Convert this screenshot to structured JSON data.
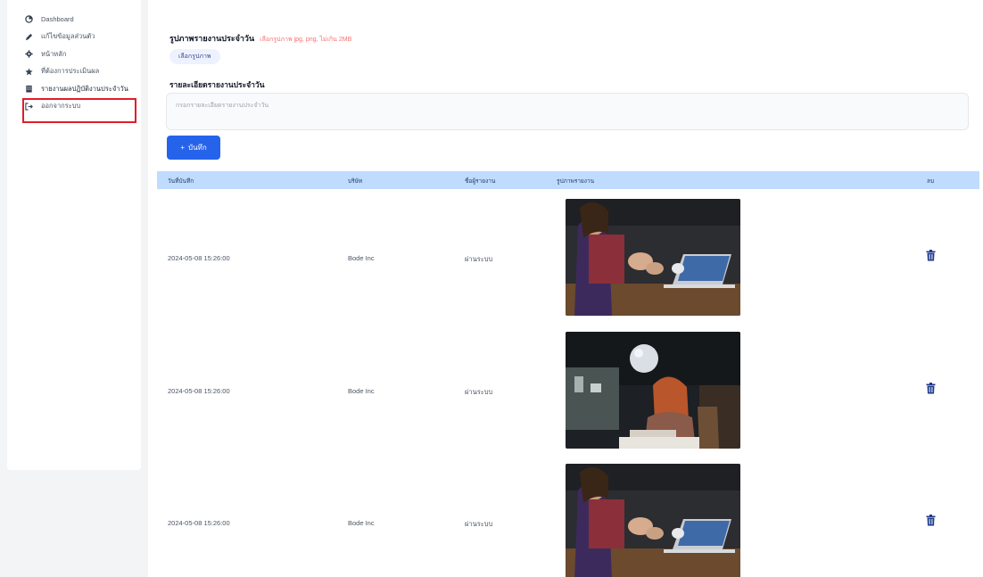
{
  "sidebar": {
    "items": [
      {
        "label": "Dashboard",
        "icon": "dashboard-icon"
      },
      {
        "label": "แก้ไขข้อมูลส่วนตัว",
        "icon": "pencil-icon"
      },
      {
        "label": "หน้าหลัก",
        "icon": "gear-icon"
      },
      {
        "label": "ที่ต้องการประเมินผล",
        "icon": "star-icon"
      },
      {
        "label": "รายงานผลปฏิบัติงานประจำวัน",
        "icon": "building-icon"
      },
      {
        "label": "ออกจากระบบ",
        "icon": "logout-icon"
      }
    ]
  },
  "form": {
    "upload_label": "รูปภาพรายงานประจำวัน",
    "upload_hint": "เลือกรูปภาพ jpg, png, ไม่เกิน 2MB",
    "choose_file_label": "เลือกรูปภาพ",
    "description_label": "รายละเอียดรายงานประจำวัน",
    "description_placeholder": "กรอกรายละเอียดรายงานประจำวัน",
    "save_label": "บันทึก"
  },
  "table": {
    "headers": [
      "วันที่บันทึก",
      "บริษัท",
      "ชื่อผู้รายงาน",
      "รูปภาพรายงาน",
      "ลบ"
    ],
    "rows": [
      {
        "date": "2024-05-08 15:26:00",
        "company": "Bode Inc",
        "status": "ผ่านระบบ",
        "image": "people-meeting-laptop-photo"
      },
      {
        "date": "2024-05-08 15:26:00",
        "company": "Bode Inc",
        "status": "ผ่านระบบ",
        "image": "woman-cafe-laptop-photo"
      },
      {
        "date": "2024-05-08 15:26:00",
        "company": "Bode Inc",
        "status": "ผ่านระบบ",
        "image": "people-meeting-laptop-photo"
      }
    ]
  },
  "colors": {
    "accent": "#2563eb",
    "table_header": "#bfdbfe",
    "highlight": "#e11d2a",
    "delete_icon": "#1e3a8a"
  }
}
